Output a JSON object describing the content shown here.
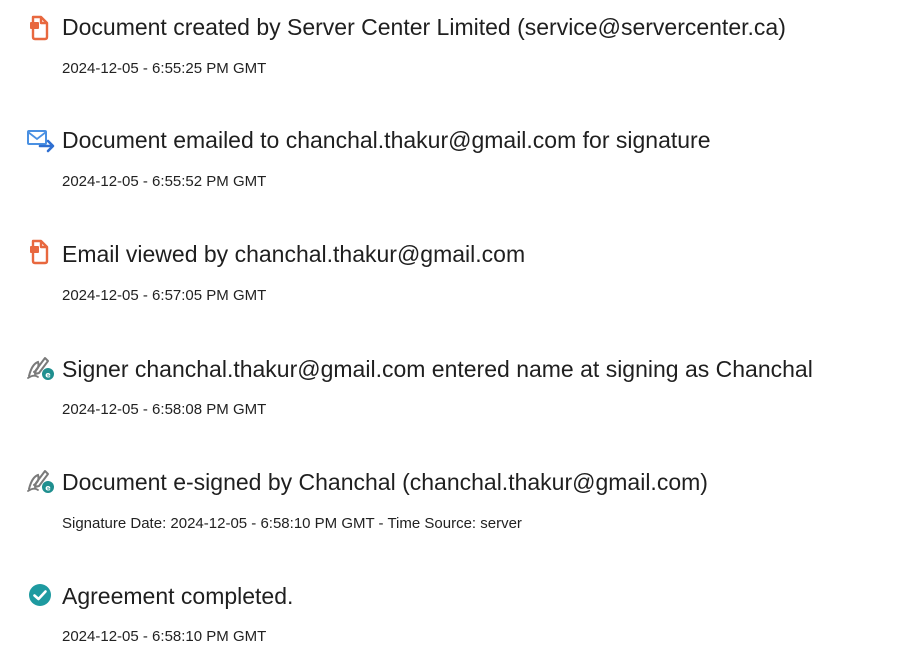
{
  "audit_trail": {
    "events": [
      {
        "icon": "document-icon",
        "title": "Document created by Server Center Limited (service@servercenter.ca)",
        "meta": "2024-12-05 - 6:55:25 PM GMT"
      },
      {
        "icon": "email-sent-icon",
        "title": "Document emailed to chanchal.thakur@gmail.com for signature",
        "meta": "2024-12-05 - 6:55:52 PM GMT"
      },
      {
        "icon": "document-icon",
        "title": "Email viewed by chanchal.thakur@gmail.com",
        "meta": "2024-12-05 - 6:57:05 PM GMT"
      },
      {
        "icon": "e-sign-pen-icon",
        "title": "Signer chanchal.thakur@gmail.com entered name at signing as Chanchal",
        "meta": "2024-12-05 - 6:58:08 PM GMT"
      },
      {
        "icon": "e-sign-pen-icon",
        "title": "Document e-signed by Chanchal (chanchal.thakur@gmail.com)",
        "meta": "Signature Date: 2024-12-05 - 6:58:10 PM GMT - Time Source: server"
      },
      {
        "icon": "check-circle-icon",
        "title": "Agreement completed.",
        "meta": "2024-12-05 - 6:58:10 PM GMT"
      }
    ]
  },
  "colors": {
    "accent_orange": "#e8683f",
    "email_blue": "#4a90e2",
    "sign_gray": "#7a7a7a",
    "sign_badge_teal": "#1f8f8f",
    "check_teal": "#1e9aa0",
    "text": "#1f1f1f"
  }
}
